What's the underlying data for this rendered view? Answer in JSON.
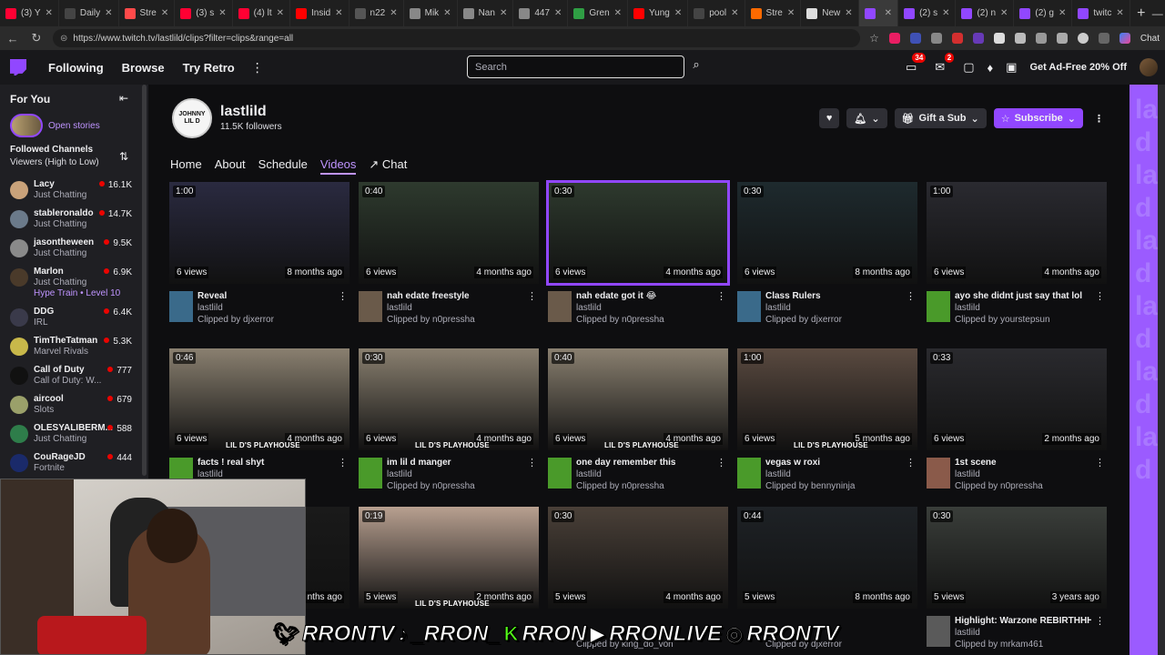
{
  "browser": {
    "tabs": [
      {
        "label": "(3) Y",
        "color": "#ff0033"
      },
      {
        "label": "Daily",
        "color": "#444444"
      },
      {
        "label": "Stre",
        "color": "#ff4a4a"
      },
      {
        "label": "(3) s",
        "color": "#ff0033"
      },
      {
        "label": "(4) lt",
        "color": "#ff0033"
      },
      {
        "label": "Insid",
        "color": "#ff0000"
      },
      {
        "label": "n22",
        "color": "#555555"
      },
      {
        "label": "Mik",
        "color": "#888888"
      },
      {
        "label": "Nan",
        "color": "#888888"
      },
      {
        "label": "447",
        "color": "#888888"
      },
      {
        "label": "Gren",
        "color": "#2f9e44"
      },
      {
        "label": "Yung",
        "color": "#ff0000"
      },
      {
        "label": "pool",
        "color": "#444444"
      },
      {
        "label": "Stre",
        "color": "#ff6a00"
      },
      {
        "label": "New",
        "color": "#dddddd"
      },
      {
        "label": "",
        "color": "#9147ff",
        "active": true
      },
      {
        "label": "(2) s",
        "color": "#9147ff"
      },
      {
        "label": "(2) n",
        "color": "#9147ff"
      },
      {
        "label": "(2) g",
        "color": "#9147ff"
      },
      {
        "label": "twitc",
        "color": "#9147ff"
      }
    ],
    "url": "https://www.twitch.tv/lastlild/clips?filter=clips&range=all",
    "profile_label": "Chat"
  },
  "topnav": {
    "following": "Following",
    "browse": "Browse",
    "try_retro": "Try Retro",
    "search_placeholder": "Search",
    "badge_notifications": "34",
    "badge_inbox": "2",
    "ad_free": "Get Ad-Free 20% Off"
  },
  "sidebar": {
    "title": "For You",
    "open_stories": "Open stories",
    "followed_header": "Followed Channels",
    "sort_label": "Viewers (High to Low)",
    "channels": [
      {
        "name": "Lacy",
        "game": "Just Chatting",
        "viewers": "16.1K",
        "color": "#c9a27a"
      },
      {
        "name": "stableronaldo",
        "game": "Just Chatting",
        "viewers": "14.7K",
        "color": "#6b7a8a"
      },
      {
        "name": "jasontheween",
        "game": "Just Chatting",
        "viewers": "9.5K",
        "color": "#8a8a8a"
      },
      {
        "name": "Marlon",
        "game": "Just Chatting",
        "hype": "Hype Train • Level 10",
        "viewers": "6.9K",
        "color": "#4a3a2a"
      },
      {
        "name": "DDG",
        "game": "IRL",
        "viewers": "6.4K",
        "color": "#3a3a4a"
      },
      {
        "name": "TimTheTatman",
        "game": "Marvel Rivals",
        "viewers": "5.3K",
        "color": "#c8b84a"
      },
      {
        "name": "Call of Duty",
        "game": "Call of Duty: W...",
        "viewers": "777",
        "color": "#111111"
      },
      {
        "name": "aircool",
        "game": "Slots",
        "viewers": "679",
        "color": "#9aa06a"
      },
      {
        "name": "OLESYALIBERM...",
        "game": "Just Chatting",
        "viewers": "588",
        "color": "#2e7d4a"
      },
      {
        "name": "CouRageJD",
        "game": "Fortnite",
        "viewers": "444",
        "color": "#1a2a6a"
      }
    ]
  },
  "channel": {
    "avatar_text": "JOHNNY LIL D",
    "name": "lastlild",
    "followers": "11.5K followers",
    "gift": "Gift a Sub",
    "subscribe": "Subscribe",
    "tabs": [
      "Home",
      "About",
      "Schedule",
      "Videos",
      "Chat"
    ],
    "active_tab": "Videos"
  },
  "clips": [
    {
      "duration": "1:00",
      "views": "6 views",
      "ago": "8 months ago",
      "title": "Reveal",
      "channel": "lastlild",
      "by": "Clipped by djxerror",
      "bg": "#2a2a40",
      "cav": "#3a6a8a"
    },
    {
      "duration": "0:40",
      "views": "6 views",
      "ago": "4 months ago",
      "title": "nah edate freestyle",
      "channel": "lastlild",
      "by": "Clipped by n0pressha",
      "bg": "#2e3a2e",
      "cav": "#6a5a4a"
    },
    {
      "duration": "0:30",
      "views": "6 views",
      "ago": "4 months ago",
      "title": "nah edate got it 😂",
      "channel": "lastlild",
      "by": "Clipped by n0pressha",
      "bg": "#2e3a2e",
      "cav": "#6a5a4a",
      "hover": true
    },
    {
      "duration": "0:30",
      "views": "6 views",
      "ago": "8 months ago",
      "title": "Class Rulers",
      "channel": "lastlild",
      "by": "Clipped by djxerror",
      "bg": "#1e2a2e",
      "cav": "#3a6a8a"
    },
    {
      "duration": "1:00",
      "views": "6 views",
      "ago": "4 months ago",
      "title": "ayo she didnt just say that lol",
      "channel": "lastlild",
      "by": "Clipped by yourstepsun",
      "bg": "#2a2a30",
      "cav": "#4a9a2a"
    },
    {
      "duration": "0:46",
      "views": "6 views",
      "ago": "4 months ago",
      "title": "facts ! real shyt",
      "channel": "lastlild",
      "by": "",
      "bg": "#8a8070",
      "cav": "#4a9a2a",
      "brand": "LIL D'S PLAYHOUSE"
    },
    {
      "duration": "0:30",
      "views": "6 views",
      "ago": "4 months ago",
      "title": "im lil d manger",
      "channel": "lastlild",
      "by": "Clipped by n0pressha",
      "bg": "#8a8070",
      "cav": "#4a9a2a",
      "brand": "LIL D'S PLAYHOUSE"
    },
    {
      "duration": "0:40",
      "views": "6 views",
      "ago": "4 months ago",
      "title": "one day remember this",
      "channel": "lastlild",
      "by": "Clipped by n0pressha",
      "bg": "#8a8070",
      "cav": "#4a9a2a",
      "brand": "LIL D'S PLAYHOUSE"
    },
    {
      "duration": "1:00",
      "views": "6 views",
      "ago": "5 months ago",
      "title": "vegas w roxi",
      "channel": "lastlild",
      "by": "Clipped by bennyninja",
      "bg": "#5a4a40",
      "cav": "#4a9a2a",
      "brand": "LIL D'S PLAYHOUSE"
    },
    {
      "duration": "0:33",
      "views": "6 views",
      "ago": "2 months ago",
      "title": "1st scene",
      "channel": "lastlild",
      "by": "Clipped by n0pressha",
      "bg": "#2a2a2e",
      "cav": "#8a5a4a"
    },
    {
      "duration": "",
      "views": "",
      "ago": "nths ago",
      "title": "",
      "channel": "",
      "by": "",
      "bg": "#1a1a1a",
      "cav": "#1a1a1a"
    },
    {
      "duration": "0:19",
      "views": "5 views",
      "ago": "2 months ago",
      "title": "",
      "channel": "",
      "by": "",
      "bg": "#b8a090",
      "cav": "#0e0e10",
      "brand": "LIL D'S PLAYHOUSE"
    },
    {
      "duration": "0:30",
      "views": "5 views",
      "ago": "4 months ago",
      "title": "",
      "channel": "",
      "by": "Clipped by king_do_von",
      "bg": "#4a4038",
      "cav": "#0e0e10"
    },
    {
      "duration": "0:44",
      "views": "5 views",
      "ago": "8 months ago",
      "title": "",
      "channel": "",
      "by": "Clipped by djxerror",
      "bg": "#1e2226",
      "cav": "#0e0e10"
    },
    {
      "duration": "0:30",
      "views": "5 views",
      "ago": "3 years ago",
      "title": "Highlight: Warzone REBIRTHHH...",
      "channel": "lastlild",
      "by": "Clipped by mrkam461",
      "bg": "#3a3e3a",
      "cav": "#5a5a5a"
    }
  ],
  "overlay": {
    "social_1": "RRONTV",
    "social_2": "_RRON_",
    "social_3": "RRON",
    "social_4": "RRONLIVE",
    "social_5": "RRONTV"
  },
  "rail_text": "la d la d la d la d la d la d"
}
